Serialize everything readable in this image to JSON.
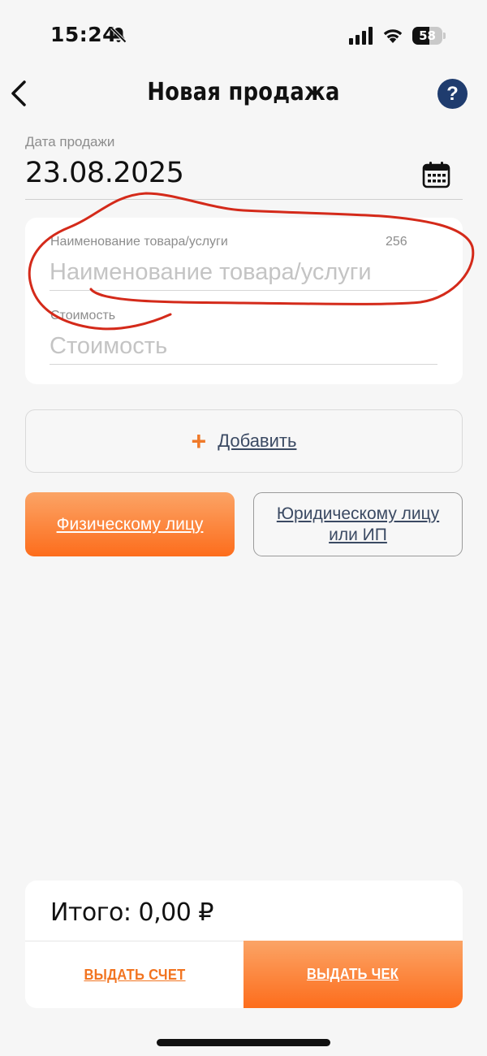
{
  "status_bar": {
    "time": "15:24",
    "battery_level": "58",
    "battery_fraction": 0.58
  },
  "nav": {
    "title": "Новая продажа",
    "help_label": "?"
  },
  "date": {
    "label": "Дата продажи",
    "value": "23.08.2025"
  },
  "item": {
    "name_label": "Наименование товара/услуги",
    "name_counter": "256",
    "name_placeholder": "Наименование товара/услуги",
    "price_label": "Стоимость",
    "price_placeholder": "Стоимость"
  },
  "add": {
    "label": "Добавить"
  },
  "customer_type": {
    "individual": "Физическому лицу",
    "legal": "Юридическому лицу или ИП"
  },
  "footer": {
    "total": "Итого: 0,00 ₽",
    "invoice_button": "ВЫДАТЬ СЧЕТ",
    "receipt_button": "ВЫДАТЬ ЧЕК"
  },
  "colors": {
    "accent_orange": "#fd6d1c",
    "help_blue": "#1f3c6e",
    "annotation_red": "#d42a1a"
  }
}
